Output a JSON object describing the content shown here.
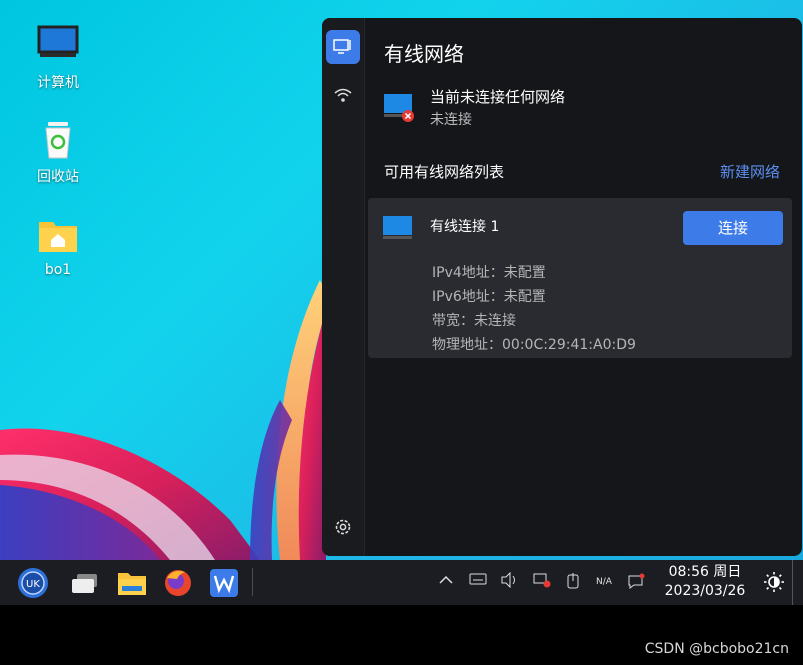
{
  "desktop": {
    "icons": [
      {
        "label": "计算机",
        "icon": "computer-icon"
      },
      {
        "label": "回收站",
        "icon": "recycle-bin-icon"
      },
      {
        "label": "bo1",
        "icon": "home-folder-icon"
      }
    ]
  },
  "panel": {
    "title": "有线网络",
    "status_main": "当前未连接任何网络",
    "status_sub": "未连接",
    "list_title": "可用有线网络列表",
    "new_network": "新建网络",
    "connection": {
      "name": "有线连接 1",
      "connect_label": "连接",
      "ipv4": "IPv4地址：未配置",
      "ipv6": "IPv6地址：未配置",
      "bandwidth": "带宽：未连接",
      "mac": "物理地址：00:0C:29:41:A0:D9"
    },
    "sidebar": [
      "wired-network-icon",
      "wifi-icon",
      "settings-icon"
    ]
  },
  "taskbar": {
    "tray_na": "N/A",
    "time": "08:56 周日",
    "date": "2023/03/26"
  },
  "watermark": "CSDN @bcbobo21cn",
  "colors": {
    "accent": "#3d7ce8",
    "link": "#5b8ff0",
    "panel_bg": "#151619",
    "card_bg": "#2a2b30"
  }
}
